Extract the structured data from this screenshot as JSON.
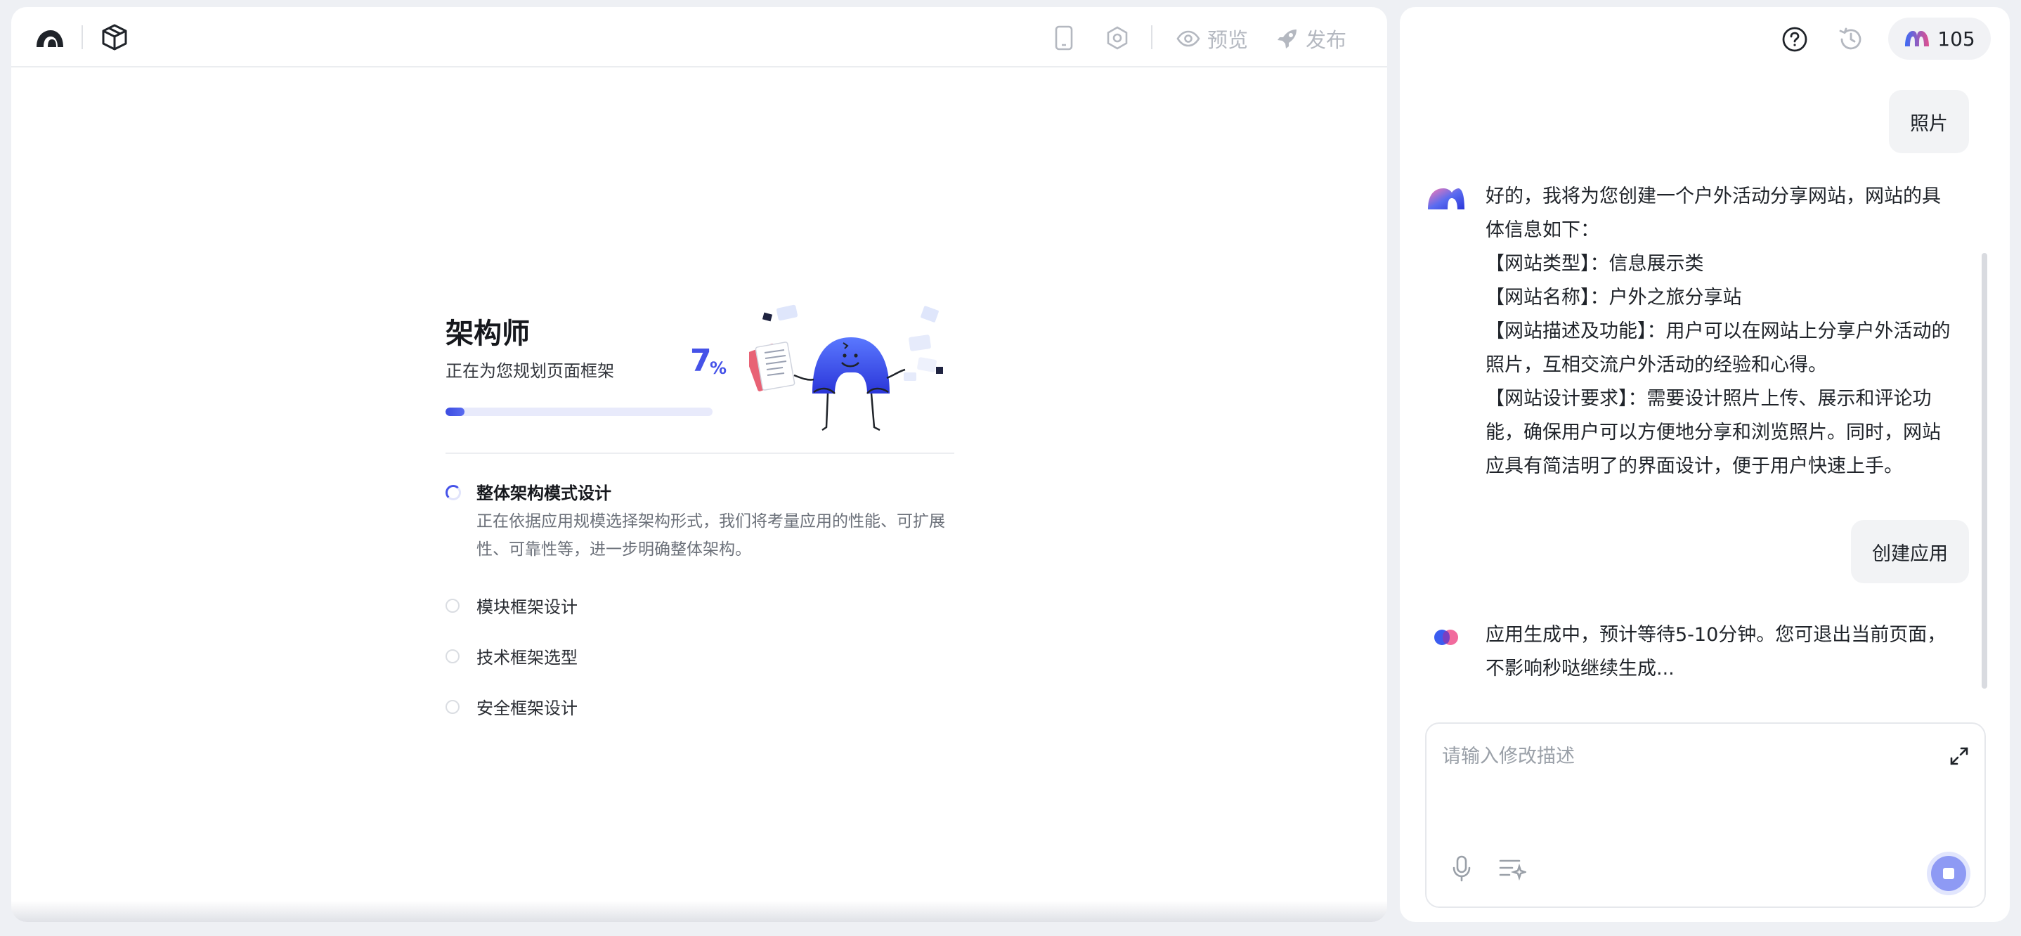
{
  "toolbar": {
    "preview_label": "预览",
    "publish_label": "发布"
  },
  "agent": {
    "title": "架构师",
    "subtitle": "正在为您规划页面框架",
    "progress_value": "7",
    "progress_unit": "%",
    "progress_fraction": 0.07
  },
  "steps": [
    {
      "label": "整体架构模式设计",
      "status": "in-progress",
      "description": "正在依据应用规模选择架构形式，我们将考量应用的性能、可扩展性、可靠性等，进一步明确整体架构。"
    },
    {
      "label": "模块框架设计",
      "status": "pending"
    },
    {
      "label": "技术框架选型",
      "status": "pending"
    },
    {
      "label": "安全框架设计",
      "status": "pending"
    }
  ],
  "header": {
    "credits": "105"
  },
  "chat": {
    "user_msg_1": "照片",
    "bot_msg_1": [
      "好的，我将为您创建一个户外活动分享网站，网站的具",
      "体信息如下：",
      "【网站类型】：信息展示类",
      "【网站名称】：户外之旅分享站",
      "【网站描述及功能】：用户可以在网站上分享户外活动的",
      "照片，互相交流户外活动的经验和心得。",
      "【网站设计要求】：需要设计照片上传、展示和评论功",
      "能，确保用户可以方便地分享和浏览照片。同时，网站",
      "应具有简洁明了的界面设计，便于用户快速上手。"
    ],
    "user_msg_2": "创建应用",
    "bot_msg_2": [
      "应用生成中，预计等待5-10分钟。您可退出当前页面，",
      "不影响秒哒继续生成..."
    ]
  },
  "composer": {
    "placeholder": "请输入修改描述"
  },
  "colors": {
    "accent": "#4552e8",
    "brand_gradient_start": "#3b6cf6",
    "brand_gradient_end": "#e0508e"
  },
  "icons": [
    "logo-icon",
    "cube-icon",
    "mobile-icon",
    "settings-icon",
    "eye-icon",
    "rocket-icon",
    "help-icon",
    "history-icon",
    "brand-icon",
    "expand-icon",
    "microphone-icon",
    "prompt-list-icon",
    "stop-icon"
  ]
}
